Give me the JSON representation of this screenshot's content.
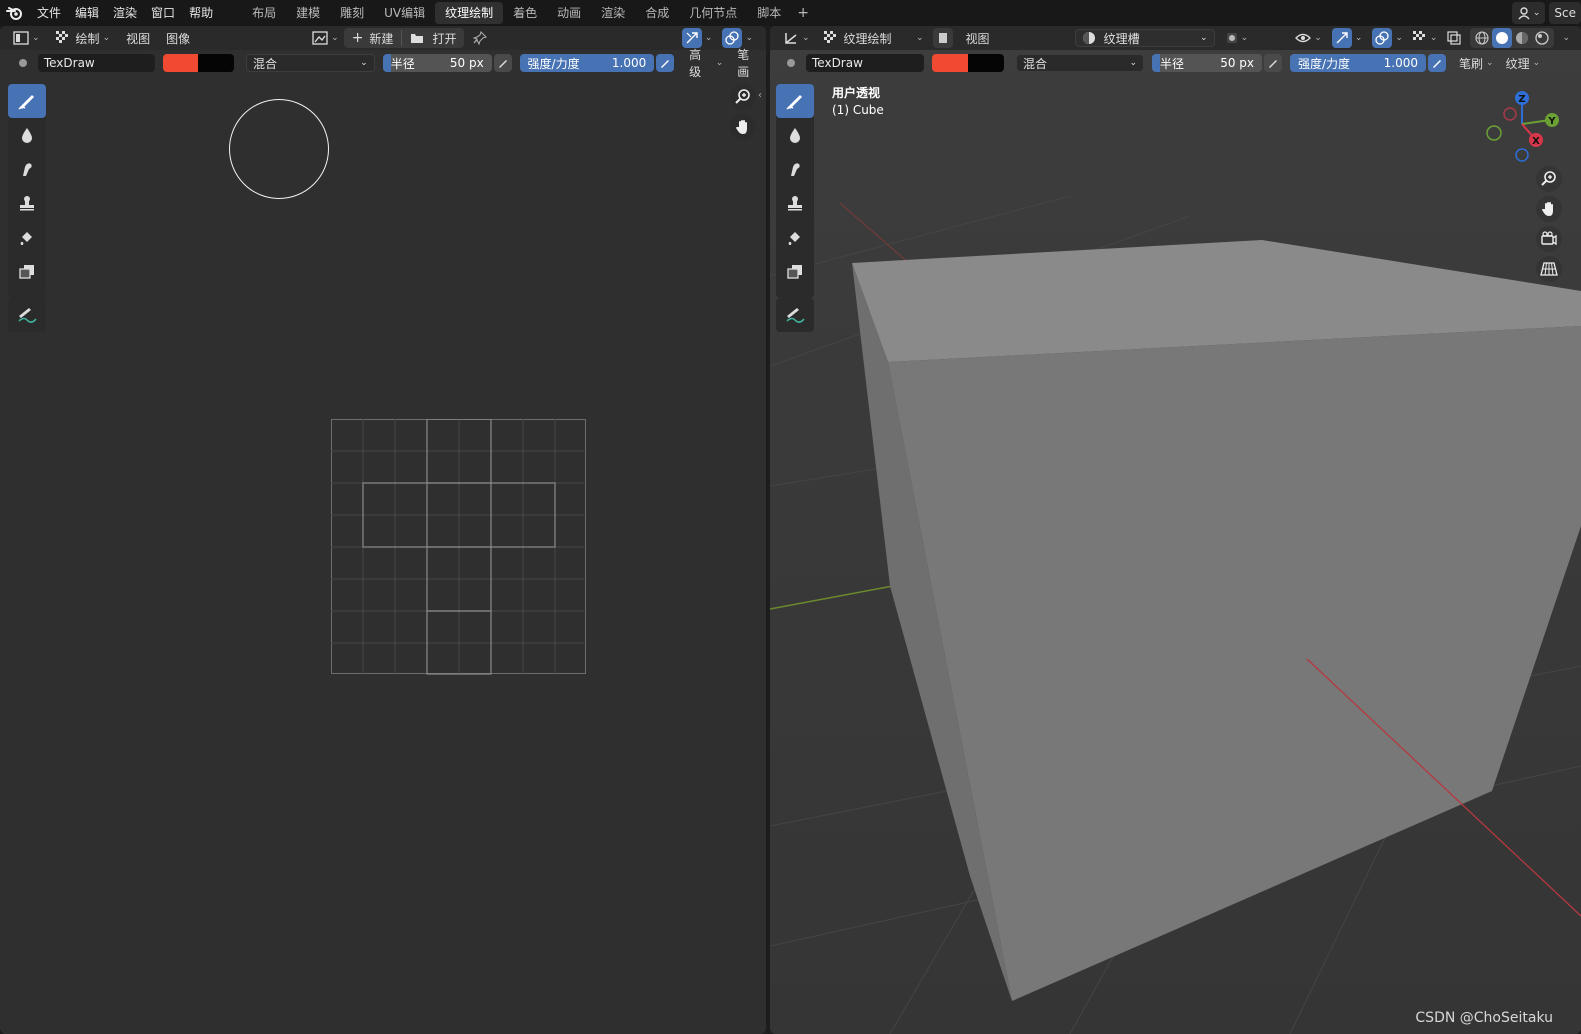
{
  "topbar": {
    "menus": [
      "文件",
      "编辑",
      "渲染",
      "窗口",
      "帮助"
    ],
    "tabs": [
      {
        "label": "布局",
        "active": false
      },
      {
        "label": "建模",
        "active": false
      },
      {
        "label": "雕刻",
        "active": false
      },
      {
        "label": "UV编辑",
        "active": false
      },
      {
        "label": "纹理绘制",
        "active": true
      },
      {
        "label": "着色",
        "active": false
      },
      {
        "label": "动画",
        "active": false
      },
      {
        "label": "渲染",
        "active": false
      },
      {
        "label": "合成",
        "active": false
      },
      {
        "label": "几何节点",
        "active": false
      },
      {
        "label": "脚本",
        "active": false
      }
    ],
    "add_tab": "+",
    "scene_label": "Sce"
  },
  "left": {
    "mode_label": "绘制",
    "view_label": "视图",
    "image_label": "图像",
    "new_label": "新建",
    "open_label": "打开",
    "brush_name": "TexDraw",
    "blend_label": "混合",
    "radius_label": "半径",
    "radius_value": "50 px",
    "strength_label": "强度/力度",
    "strength_value": "1.000",
    "advanced_label": "高级",
    "stroke_label": "笔画"
  },
  "right": {
    "mode_label": "纹理绘制",
    "view_label": "视图",
    "texture_slot_label": "纹理槽",
    "brush_name": "TexDraw",
    "blend_label": "混合",
    "radius_label": "半径",
    "radius_value": "50 px",
    "strength_label": "强度/力度",
    "strength_value": "1.000",
    "brush_label": "笔刷",
    "texture_label": "纹理",
    "viewport_title": "用户透视",
    "object_name": "(1) Cube",
    "gizmo": {
      "x": "X",
      "y": "Y",
      "z": "Z"
    }
  },
  "colors": {
    "accent": "#4772b3",
    "brush_color": "#f04a32",
    "secondary_color": "#050505"
  },
  "watermark": "CSDN @ChoSeitaku"
}
